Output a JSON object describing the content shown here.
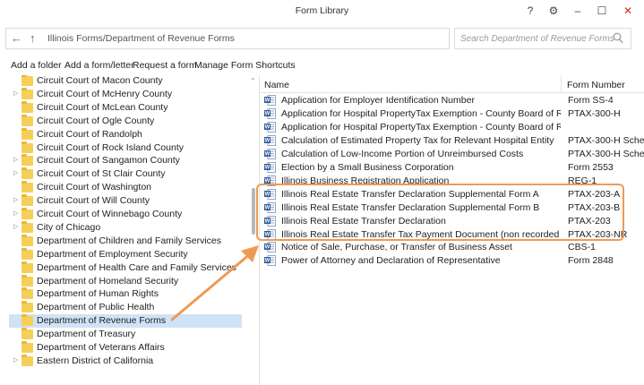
{
  "window": {
    "title": "Form Library",
    "help_glyph": "?",
    "settings_glyph": "⚙",
    "minimize_glyph": "–",
    "maximize_glyph": "☐",
    "close_glyph": "✕",
    "close_color": "#d9281e"
  },
  "address": {
    "back_glyph": "←",
    "up_glyph": "↑",
    "path": "Illinois Forms/Department of Revenue Forms"
  },
  "search": {
    "placeholder": "Search Department of Revenue Forms"
  },
  "commands": {
    "add_folder": "Add a folder",
    "add_form_letter": "Add a form/letter",
    "request_form": "Request a form",
    "manage_shortcuts": "Manage Form Shortcuts"
  },
  "tree": {
    "items": [
      {
        "label": "Circuit Court of Macon County",
        "expandable": false
      },
      {
        "label": "Circuit Court of McHenry County",
        "expandable": true
      },
      {
        "label": "Circuit Court of McLean County",
        "expandable": false
      },
      {
        "label": "Circuit Court of Ogle County",
        "expandable": false
      },
      {
        "label": "Circuit Court of Randolph",
        "expandable": false
      },
      {
        "label": "Circuit Court of Rock Island County",
        "expandable": false
      },
      {
        "label": "Circuit Court of Sangamon County",
        "expandable": true
      },
      {
        "label": "Circuit Court of St Clair County",
        "expandable": true
      },
      {
        "label": "Circuit Court of Washington",
        "expandable": false
      },
      {
        "label": "Circuit Court of Will County",
        "expandable": true
      },
      {
        "label": "Circuit Court of Winnebago County",
        "expandable": true
      },
      {
        "label": "City of Chicago",
        "expandable": true
      },
      {
        "label": "Department of Children and Family Services",
        "expandable": false
      },
      {
        "label": "Department of Employment Security",
        "expandable": false
      },
      {
        "label": "Department of Health Care and Family Services",
        "expandable": false
      },
      {
        "label": "Department of Homeland Security",
        "expandable": false
      },
      {
        "label": "Department of Human Rights",
        "expandable": false
      },
      {
        "label": "Department of Public Health",
        "expandable": false
      },
      {
        "label": "Department of Revenue Forms",
        "expandable": false,
        "selected": true
      },
      {
        "label": "Department of Treasury",
        "expandable": false
      },
      {
        "label": "Department of Veterans Affairs",
        "expandable": false
      },
      {
        "label": "Eastern District of California",
        "expandable": true
      }
    ],
    "expand_glyph": "▷"
  },
  "list": {
    "col_name": "Name",
    "col_number": "Form Number",
    "rows": [
      {
        "name": "Application for Employer Identification Number",
        "number": "Form SS-4"
      },
      {
        "name": "Application for Hospital PropertyTax Exemption - County Board of Review...",
        "number": "PTAX-300-H"
      },
      {
        "name": "Application for Hospital PropertyTax Exemption - County Board of Review...",
        "number": ""
      },
      {
        "name": "Calculation of Estimated Property Tax for Relevant Hospital Entity",
        "number": "PTAX-300-H Sche"
      },
      {
        "name": "Calculation of Low-Income Portion of Unreimbursed Costs",
        "number": "PTAX-300-H Sche"
      },
      {
        "name": "Election by a Small Business Corporation",
        "number": "Form 2553"
      },
      {
        "name": "Illinois Business Registration Application",
        "number": "REG-1"
      },
      {
        "name": "Illinois Real Estate Transfer Declaration Supplemental Form A",
        "number": "PTAX-203-A"
      },
      {
        "name": "Illinois Real Estate Transfer Declaration Supplemental Form B",
        "number": "PTAX-203-B"
      },
      {
        "name": "Illinois Real Estate Transfer Declaration",
        "number": "PTAX-203"
      },
      {
        "name": "Illinois Real Estate Transfer Tax Payment Document (non recorded transfers)",
        "number": "PTAX-203-NR"
      },
      {
        "name": "Notice of Sale, Purchase, or Transfer of Business Asset",
        "number": "CBS-1"
      },
      {
        "name": "Power of Attorney and Declaration of Representative",
        "number": "Form 2848"
      }
    ]
  },
  "colors": {
    "accent_highlight": "#ee9a55",
    "selection": "#cfe3f7",
    "folder": "#f6cf58",
    "word_icon": "#2b579a"
  }
}
